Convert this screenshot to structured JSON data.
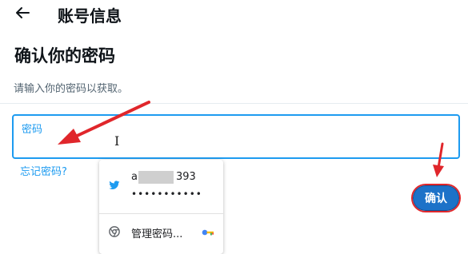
{
  "header": {
    "back_icon": "arrow-left-icon",
    "title": "账号信息"
  },
  "main": {
    "heading": "确认你的密码",
    "description": "请输入你的密码以获取。",
    "password_field": {
      "label": "密码",
      "value": ""
    },
    "forgot_link": "忘记密码?",
    "confirm_label": "确认"
  },
  "autofill": {
    "account_prefix": "a",
    "account_suffix": "393",
    "password_mask": "•••••••••••",
    "manage_label": "管理密码...",
    "icons": [
      "twitter-bird-icon",
      "chrome-icon",
      "key-icon"
    ]
  },
  "colors": {
    "accent": "#1d9bf0",
    "button": "#1d72c8",
    "annotation_red": "#e0262b"
  }
}
